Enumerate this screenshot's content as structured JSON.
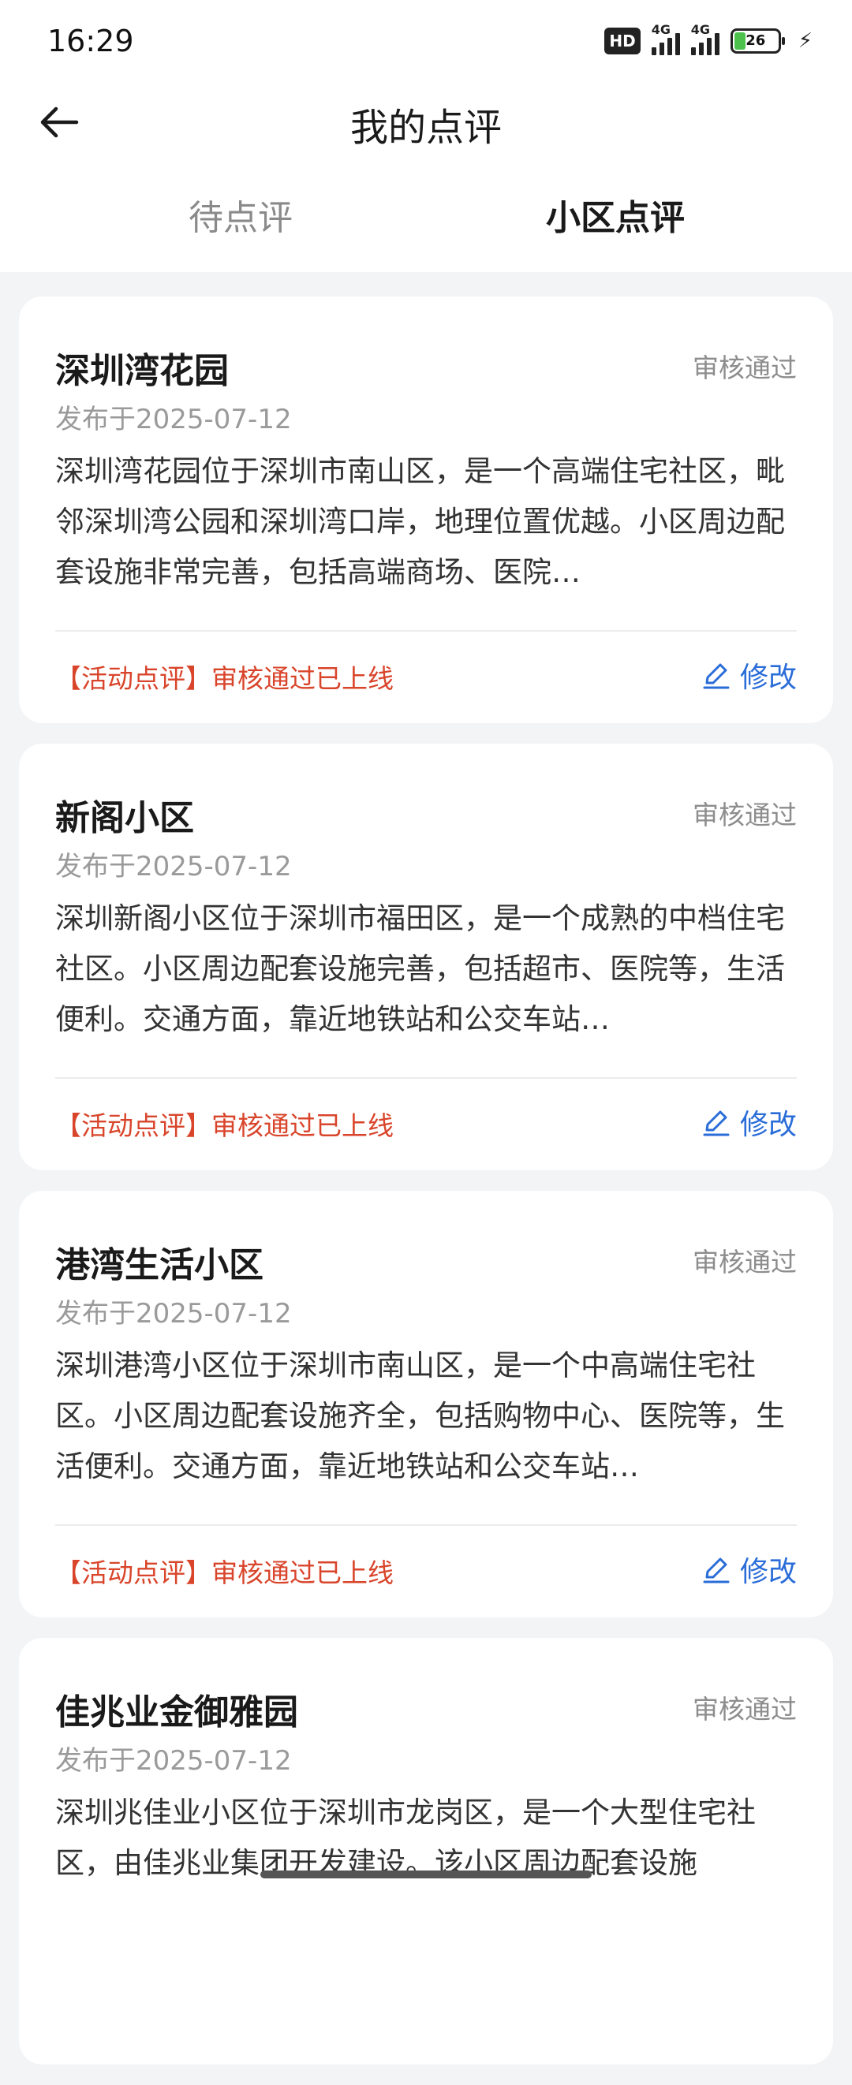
{
  "status_bar": {
    "time": "16:29",
    "hd": "HD",
    "net1": "4G",
    "net2": "4G",
    "battery": "26",
    "battery_level": 0.26
  },
  "header": {
    "title": "我的点评",
    "back_icon": "arrow-left-icon"
  },
  "tabs": [
    {
      "label": "待点评",
      "active": false
    },
    {
      "label": "小区点评",
      "active": true
    }
  ],
  "reviews": [
    {
      "name": "深圳湾花园",
      "status": "审核通过",
      "date": "发布于2025-07-12",
      "text": "深圳湾花园位于深圳市南山区，是一个高端住宅社区，毗邻深圳湾公园和深圳湾口岸，地理位置优越。小区周边配套设施非常完善，包括高端商场、医院…",
      "tag": "【活动点评】审核通过已上线",
      "edit_label": "修改"
    },
    {
      "name": "新阁小区",
      "status": "审核通过",
      "date": "发布于2025-07-12",
      "text": "深圳新阁小区位于深圳市福田区，是一个成熟的中档住宅社区。小区周边配套设施完善，包括超市、医院等，生活便利。交通方面，靠近地铁站和公交车站…",
      "tag": "【活动点评】审核通过已上线",
      "edit_label": "修改"
    },
    {
      "name": "港湾生活小区",
      "status": "审核通过",
      "date": "发布于2025-07-12",
      "text": "深圳港湾小区位于深圳市南山区，是一个中高端住宅社区。小区周边配套设施齐全，包括购物中心、医院等，生活便利。交通方面，靠近地铁站和公交车站…",
      "tag": "【活动点评】审核通过已上线",
      "edit_label": "修改"
    },
    {
      "name": "佳兆业金御雅园",
      "status": "审核通过",
      "date": "发布于2025-07-12",
      "text": "深圳兆佳业小区位于深圳市龙岗区，是一个大型住宅社区，由佳兆业集团开发建设。该小区周边配套设施",
      "tag": "",
      "edit_label": ""
    }
  ],
  "colors": {
    "accent": "#2a6dd8",
    "tag_red": "#d9452b",
    "background": "#f3f4f6"
  }
}
